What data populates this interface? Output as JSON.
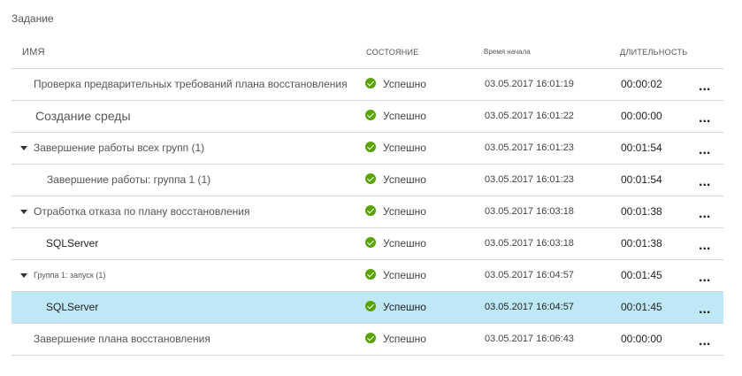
{
  "page": {
    "title": "Задание"
  },
  "columns": {
    "name": "ИМЯ",
    "status": "СОСТОЯНИЕ",
    "start": "Время начала",
    "duration": "ДЛИТЕЛЬНОСТЬ"
  },
  "more_label": "...",
  "rows": [
    {
      "name": "Проверка предварительных требований плана восстановления",
      "status": "Успешно",
      "start": "03.05.2017 16:01:19",
      "duration": "00:00:02"
    },
    {
      "name": "Создание среды",
      "status": "Успешно",
      "start": "03.05.2017 16:01:22",
      "duration": "00:00:00"
    },
    {
      "name": "Завершение работы всех групп (1)",
      "status": "Успешно",
      "start": "03.05.2017 16:01:23",
      "duration": "00:01:54",
      "expanded": true
    },
    {
      "name": "Завершение работы: группа 1 (1)",
      "status": "Успешно",
      "start": "03.05.2017 16:01:23",
      "duration": "00:01:54"
    },
    {
      "name": "Отработка отказа по плану восстановления",
      "status": "Успешно",
      "start": "03.05.2017 16:03:18",
      "duration": "00:01:38",
      "expanded": true
    },
    {
      "name": "SQLServer",
      "status": "Успешно",
      "start": "03.05.2017 16:03:18",
      "duration": "00:01:38"
    },
    {
      "name": "Группа 1: запуск (1)",
      "status": "Успешно",
      "start": "03.05.2017 16:04:57",
      "duration": "00:01:45",
      "expanded": true
    },
    {
      "name": "SQLServer",
      "status": "Успешно",
      "start": "03.05.2017 16:04:57",
      "duration": "00:01:45",
      "selected": true
    },
    {
      "name": "Завершение плана восстановления",
      "status": "Успешно",
      "start": "03.05.2017 16:06:43",
      "duration": "00:00:00"
    }
  ],
  "colors": {
    "success": "#57a300",
    "selected_row": "#bfe8f7",
    "divider": "#d6d6d6"
  },
  "icons": {
    "status": "checkmark-circle-icon",
    "expand": "caret-down-icon",
    "more": "ellipsis-icon"
  }
}
